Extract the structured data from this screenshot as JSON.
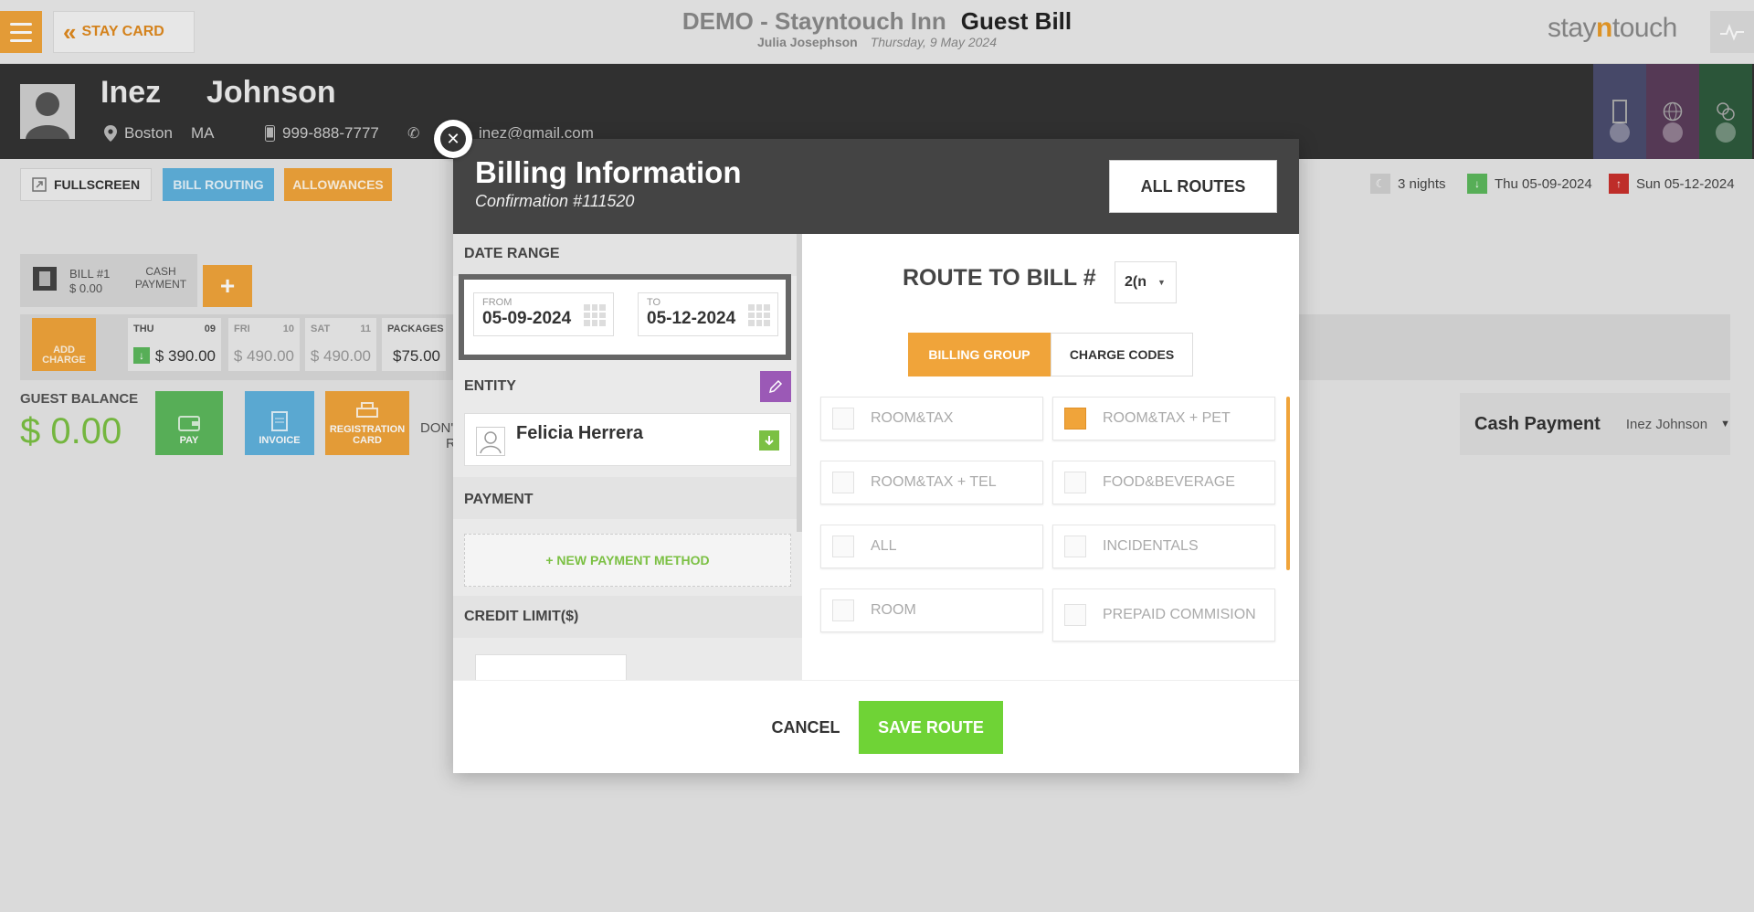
{
  "topbar": {
    "back_label": "STAY CARD",
    "hotel_name": "DEMO - Stayntouch Inn",
    "page_title": "Guest Bill",
    "user_name": "Julia Josephson",
    "business_date": "Thursday, 9 May 2024",
    "brand_pre": "stay",
    "brand_n": "n",
    "brand_post": "touch"
  },
  "guest": {
    "first_name": "Inez",
    "last_name": "Johnson",
    "city": "Boston",
    "state": "MA",
    "phone": "999-888-7777",
    "email": "inez@gmail.com"
  },
  "toolbar": {
    "fullscreen_label": "FULLSCREEN",
    "bill_routing_label": "BILL ROUTING",
    "allowances_label": "ALLOWANCES",
    "nights": "3 nights",
    "arrival": "Thu 05-09-2024",
    "departure": "Sun 05-12-2024"
  },
  "bill": {
    "tab_label": "BILL #1",
    "tab_amount": "$ 0.00",
    "tab_payment": "CASH PAYMENT",
    "add_charge_label": "ADD CHARGE",
    "days": [
      {
        "day": "THU",
        "num": "09",
        "amount": "$ 390.00"
      },
      {
        "day": "FRI",
        "num": "10",
        "amount": "$ 490.00"
      },
      {
        "day": "SAT",
        "num": "11",
        "amount": "$ 490.00"
      },
      {
        "day": "PACKAGES",
        "num": "",
        "amount": "$75.00"
      }
    ],
    "guest_balance_label": "GUEST BALANCE",
    "guest_balance": "$ 0.00",
    "pay_label": "PAY",
    "invoice_label": "INVOICE",
    "registration_label": "REGISTRATION CARD",
    "dont_text": "DON'",
    "dont_text2": "R",
    "cash_payment_label": "Cash Payment",
    "cash_payment_name": "Inez Johnson"
  },
  "modal": {
    "title": "Billing Information",
    "confirmation": "Confirmation #111520",
    "all_routes_label": "ALL ROUTES",
    "date_range_label": "DATE RANGE",
    "from_label": "FROM",
    "from_value": "05-09-2024",
    "to_label": "TO",
    "to_value": "05-12-2024",
    "entity_label": "ENTITY",
    "entity_name": "Felicia Herrera",
    "payment_label": "PAYMENT",
    "new_payment_label": "+ NEW PAYMENT METHOD",
    "credit_limit_label": "CREDIT LIMIT($)",
    "route_to_bill_label": "ROUTE TO BILL #",
    "route_to_bill_value": "2(n",
    "billing_group_label": "BILLING GROUP",
    "charge_codes_label": "CHARGE CODES",
    "groups": [
      {
        "label": "ROOM&TAX",
        "checked": false
      },
      {
        "label": "ROOM&TAX + PET",
        "checked": true
      },
      {
        "label": "ROOM&TAX + TEL",
        "checked": false
      },
      {
        "label": "FOOD&BEVERAGE",
        "checked": false
      },
      {
        "label": "ALL",
        "checked": false
      },
      {
        "label": "INCIDENTALS",
        "checked": false
      },
      {
        "label": "ROOM",
        "checked": false
      },
      {
        "label": "PREPAID COMMISION",
        "checked": false
      }
    ],
    "cancel_label": "CANCEL",
    "save_label": "SAVE ROUTE"
  },
  "colors": {
    "accent_orange": "#f0a43a",
    "accent_green": "#6fd336",
    "accent_blue": "#5fb2dd",
    "accent_purple": "#9b59b6",
    "header_dark": "#333333"
  }
}
